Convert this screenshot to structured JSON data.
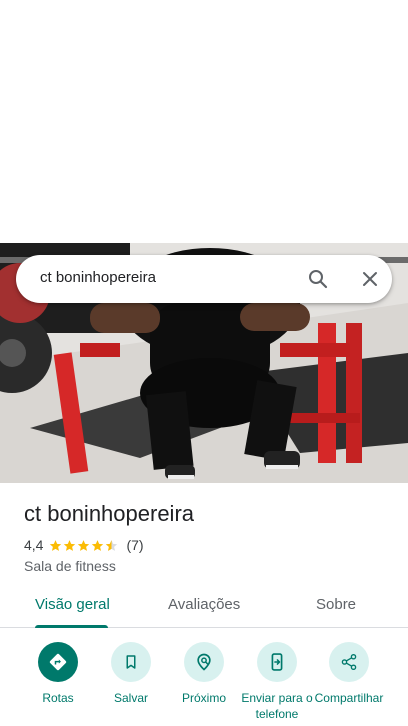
{
  "search": {
    "query": "ct boninhopereira",
    "search_icon": "search-icon",
    "close_icon": "close-icon"
  },
  "place": {
    "name": "ct boninhopereira",
    "rating": "4,4",
    "rating_value": 4.4,
    "rating_max": 5,
    "review_count": "(7)",
    "category": "Sala de fitness"
  },
  "tabs": [
    {
      "label": "Visão geral",
      "active": true
    },
    {
      "label": "Avaliações",
      "active": false
    },
    {
      "label": "Sobre",
      "active": false
    }
  ],
  "actions": [
    {
      "label": "Rotas",
      "icon": "directions-icon"
    },
    {
      "label": "Salvar",
      "icon": "bookmark-icon"
    },
    {
      "label": "Próximo",
      "icon": "nearby-icon"
    },
    {
      "label": "Enviar para o telefone",
      "icon": "send-to-phone-icon"
    },
    {
      "label": "Compartilhar",
      "icon": "share-icon"
    }
  ],
  "colors": {
    "accent": "#00796b",
    "accent_light": "#d8f1ef",
    "star": "#fbbc04"
  }
}
